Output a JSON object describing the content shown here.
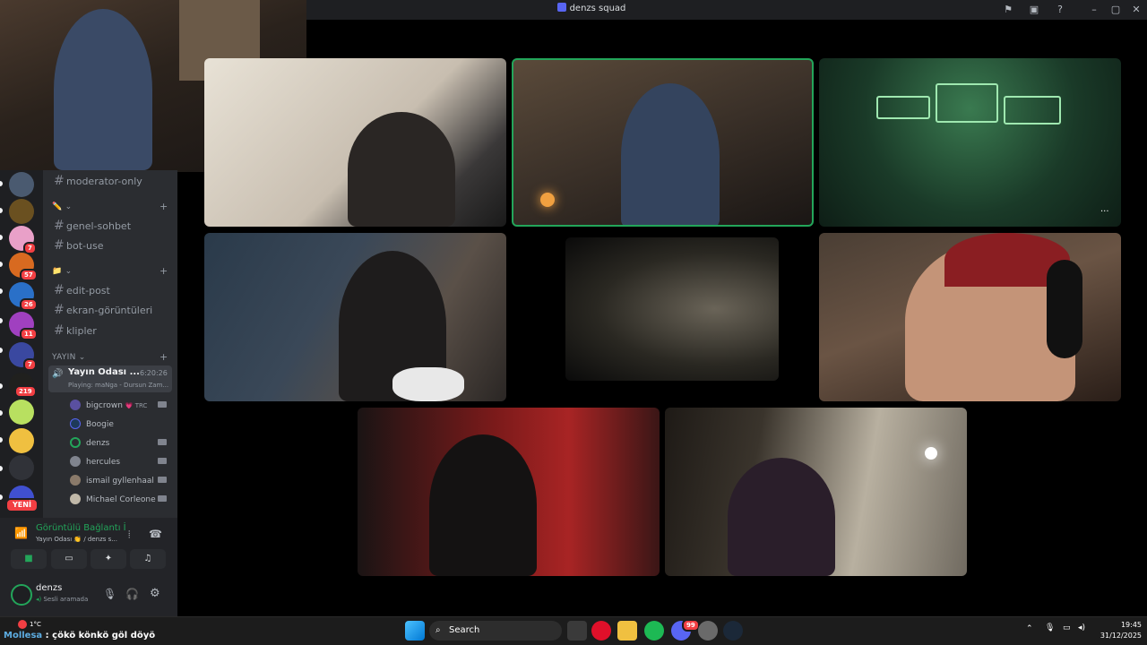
{
  "window": {
    "title": "denzs squad"
  },
  "channels": {
    "top": {
      "name": "moderator-only"
    },
    "cat1": {
      "label": "✏️ ⌄"
    },
    "group1": [
      "genel-sohbet",
      "bot-use"
    ],
    "cat2": {
      "label": "📁 ⌄"
    },
    "group2": [
      "edit-post",
      "ekran-görüntüleri",
      "klipler"
    ],
    "cat3": {
      "label": "YAYIN ⌄"
    },
    "voice_channel": {
      "name": "Yayın Odası ...",
      "timer": "6:20:26",
      "activity": "Playing: maNga - Dursun Zam..."
    },
    "members": [
      "bigcrown",
      "Boogie",
      "denzs",
      "hercules",
      "ismail gyllenhaal",
      "Michael Corleone"
    ],
    "member_tag": "💗 TRC"
  },
  "servers": {
    "badges": [
      "7",
      "57",
      "26",
      "11",
      "7",
      "219"
    ],
    "new_label": "YENİ"
  },
  "voice_panel": {
    "status": "Görüntülü Bağlantı İ",
    "detail": "Yayın Odası 👏 / denzs s...",
    "user": "denzs",
    "user_status": "Sesli aramada"
  },
  "taskbar": {
    "search_placeholder": "Search",
    "ticker_user": "Mollesa",
    "ticker_text": "çökö könkö göl döyö",
    "weather": "1°C",
    "time": "19:45",
    "date": "31/12/2025",
    "discord_badge": "99"
  },
  "tiles": {
    "more_label": "···"
  },
  "colors": {
    "discord_blurple": "#5865f2",
    "speaking_green": "#23a55a",
    "badge_red": "#f23f43",
    "rail_bg": "#1e1f22",
    "sidebar_bg": "#2b2d31"
  }
}
